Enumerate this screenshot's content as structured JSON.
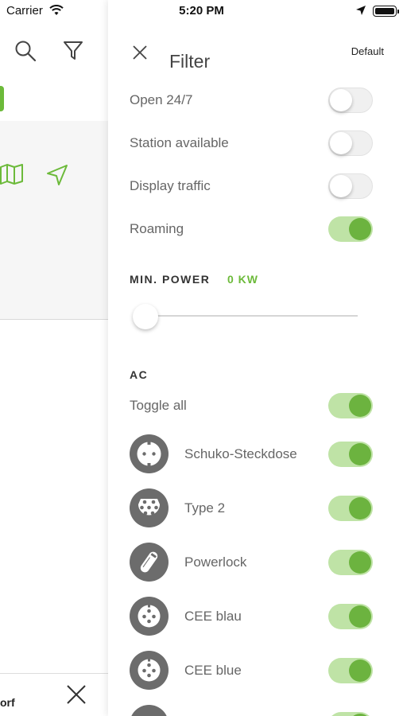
{
  "status_bar": {
    "carrier": "Carrier",
    "time": "5:20 PM"
  },
  "background_app": {
    "bottom_text": "orf"
  },
  "filter": {
    "title": "Filter",
    "default_label": "Default",
    "toggles": [
      {
        "label": "Open 24/7",
        "on": false
      },
      {
        "label": "Station available",
        "on": false
      },
      {
        "label": "Display traffic",
        "on": false
      },
      {
        "label": "Roaming",
        "on": true
      }
    ],
    "min_power": {
      "label": "MIN. POWER",
      "value": "0 KW",
      "slider_fraction": 0
    },
    "ac": {
      "heading": "AC",
      "toggle_all": {
        "label": "Toggle all",
        "on": true
      },
      "plugs": [
        {
          "label": "Schuko-Steckdose",
          "icon": "schuko-plug-icon",
          "on": true
        },
        {
          "label": "Type 2",
          "icon": "type2-plug-icon",
          "on": true
        },
        {
          "label": "Powerlock",
          "icon": "powerlock-plug-icon",
          "on": true
        },
        {
          "label": "CEE blau",
          "icon": "cee-plug-icon",
          "on": true
        },
        {
          "label": "CEE blue",
          "icon": "cee-plug-icon",
          "on": true
        }
      ]
    }
  },
  "colors": {
    "accent": "#6cba3a",
    "toggle_on_track": "#bfe3a6",
    "toggle_on_knob": "#6cb33f",
    "plug_icon_bg": "#6c6c6c"
  }
}
